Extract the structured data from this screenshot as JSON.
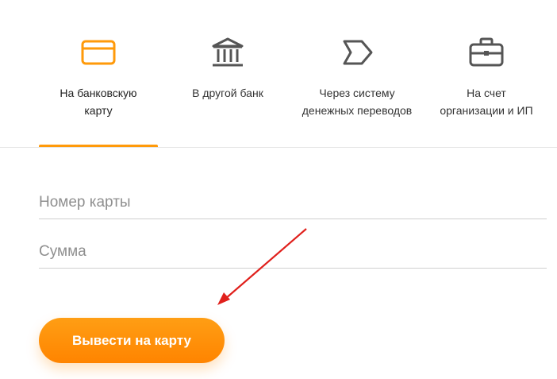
{
  "tabs": [
    {
      "label": "На банковскую\nкарту",
      "icon": "card-icon",
      "active": true
    },
    {
      "label": "В другой банк",
      "icon": "bank-icon",
      "active": false
    },
    {
      "label": "Через систему\nденежных переводов",
      "icon": "transfer-icon",
      "active": false
    },
    {
      "label": "На счет\nорганизации и ИП",
      "icon": "briefcase-icon",
      "active": false
    }
  ],
  "form": {
    "card_number_placeholder": "Номер карты",
    "amount_placeholder": "Сумма",
    "submit_label": "Вывести на карту"
  },
  "colors": {
    "accent": "#ff9a0a",
    "accent_dark": "#ff7f00",
    "icon_gray": "#555555",
    "annotation_arrow": "#e0201c"
  }
}
